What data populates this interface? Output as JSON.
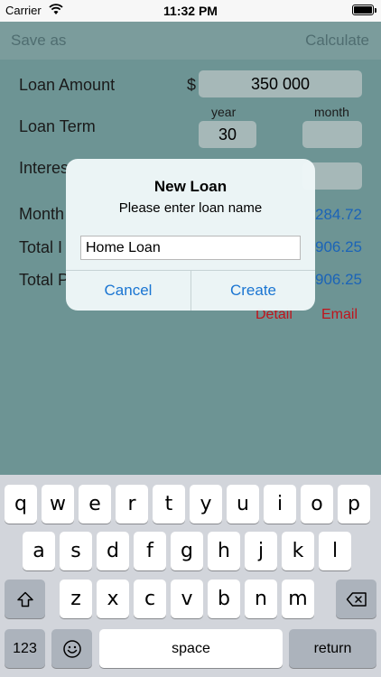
{
  "status_bar": {
    "carrier": "Carrier",
    "time": "11:32 PM"
  },
  "nav": {
    "left_button": "Save as",
    "right_button": "Calculate"
  },
  "form": {
    "loan_amount_label": "Loan Amount",
    "currency_symbol": "$",
    "loan_amount_value": "350 000",
    "loan_term_label": "Loan Term",
    "year_label": "year",
    "month_label": "month",
    "year_value": "30",
    "month_value": "",
    "interest_label": "Interes",
    "monthly_label": "Month",
    "monthly_value": "284.72",
    "total_interest_label": "Total I",
    "total_interest_value": "906.25",
    "total_payment_label": "Total P",
    "total_payment_value": "906.25",
    "detail_link": "Detail",
    "email_link": "Email"
  },
  "alert": {
    "title": "New Loan",
    "message": "Please enter loan name",
    "input_value": "Home Loan",
    "cancel_label": "Cancel",
    "create_label": "Create"
  },
  "keyboard": {
    "row1": [
      "q",
      "w",
      "e",
      "r",
      "t",
      "y",
      "u",
      "i",
      "o",
      "p"
    ],
    "row2": [
      "a",
      "s",
      "d",
      "f",
      "g",
      "h",
      "j",
      "k",
      "l"
    ],
    "row3": [
      "z",
      "x",
      "c",
      "v",
      "b",
      "n",
      "m"
    ],
    "numbers_label": "123",
    "space_label": "space",
    "return_label": "return"
  },
  "colors": {
    "background": "#6d9494",
    "nav_bar": "#7b9c9c",
    "value_blue": "#1b64b8",
    "link_red": "#c0141c",
    "alert_button": "#1a75d2"
  }
}
